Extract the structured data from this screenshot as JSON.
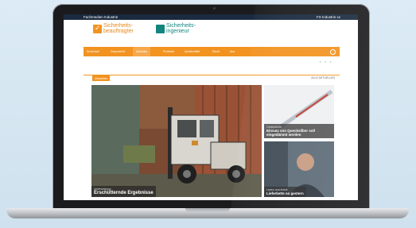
{
  "topbar": {
    "left_text": "Fachmedien Industrie",
    "right_text": "FS Industrie xx"
  },
  "logos": [
    {
      "line1": "Sicherheits-",
      "line2": "beauftragter"
    },
    {
      "line1": "Sicherheits-",
      "line2": "ingenieur"
    }
  ],
  "nav": {
    "items": [
      "Sicherheit",
      "Gesundheit",
      "Aktuelles",
      "Produkte",
      "Arbeitsmittel",
      "Recht",
      "Abo"
    ]
  },
  "section": {
    "tag": "Aktuelles",
    "all_label": "ALLE AKTUELLEN"
  },
  "hero": {
    "kicker": "Unterweisung",
    "title": "Erschütternde Ergebnisse"
  },
  "side_stories": [
    {
      "kicker": "Gefahrstoffe",
      "title": "Einsatz von Quecksilber soll eingedämmt werden"
    },
    {
      "kicker": "Leben und Arbeit",
      "title": "Lieferkette so gestern"
    }
  ]
}
